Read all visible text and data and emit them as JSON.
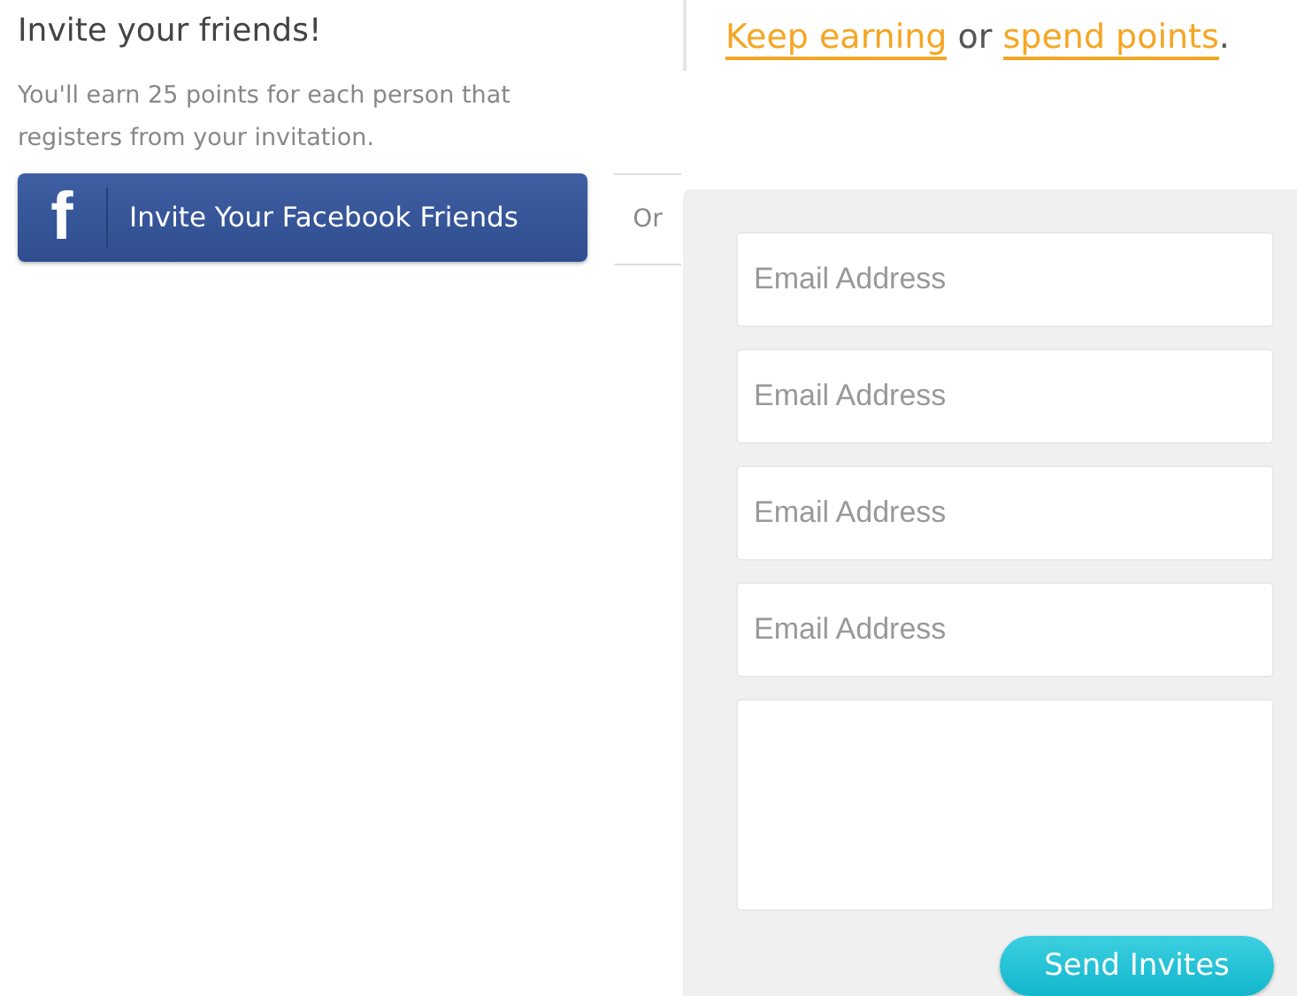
{
  "invite": {
    "title": "Invite your friends!",
    "description": "You'll earn 25 points for each person that registers from your invitation.",
    "facebook_button": {
      "icon": "f",
      "label": "Invite Your Facebook Friends"
    },
    "separator": "Or"
  },
  "links_sentence": [
    {
      "kind": "link",
      "text": "Keep earning"
    },
    {
      "kind": "text",
      "text": " or "
    },
    {
      "kind": "link",
      "text": "spend points"
    },
    {
      "kind": "text",
      "text": "."
    }
  ],
  "email_form": {
    "fields": [
      {
        "placeholder": "Email Address"
      },
      {
        "placeholder": "Email Address"
      },
      {
        "placeholder": "Email Address"
      },
      {
        "placeholder": "Email Address"
      }
    ],
    "send_button": "Send Invites"
  }
}
